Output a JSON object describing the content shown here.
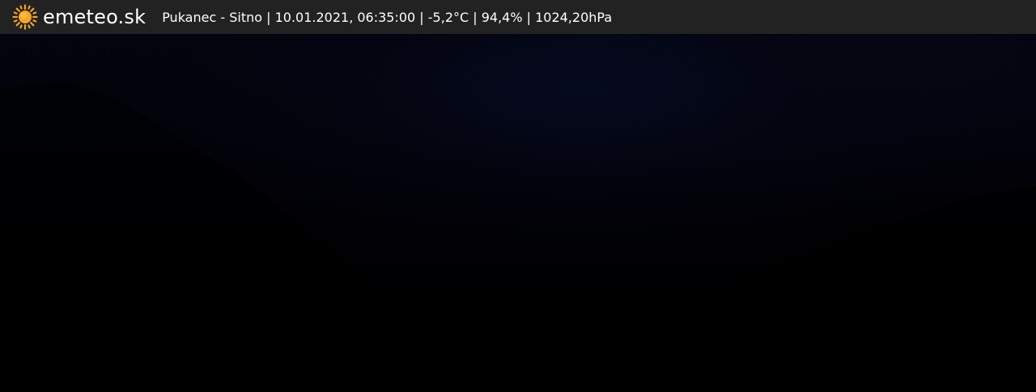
{
  "header": {
    "logo_icon": "sun-icon",
    "logo_text": "emeteo.sk",
    "station_info": "Pukanec - Sitno | 10.01.2021, 06:35:00 | -5,2°C | 94,4% | 1024,20hPa"
  },
  "colors": {
    "header_background": "#222222",
    "header_text": "#ffffff",
    "sun_icon": "#f5a623",
    "image_background": "#000000"
  }
}
